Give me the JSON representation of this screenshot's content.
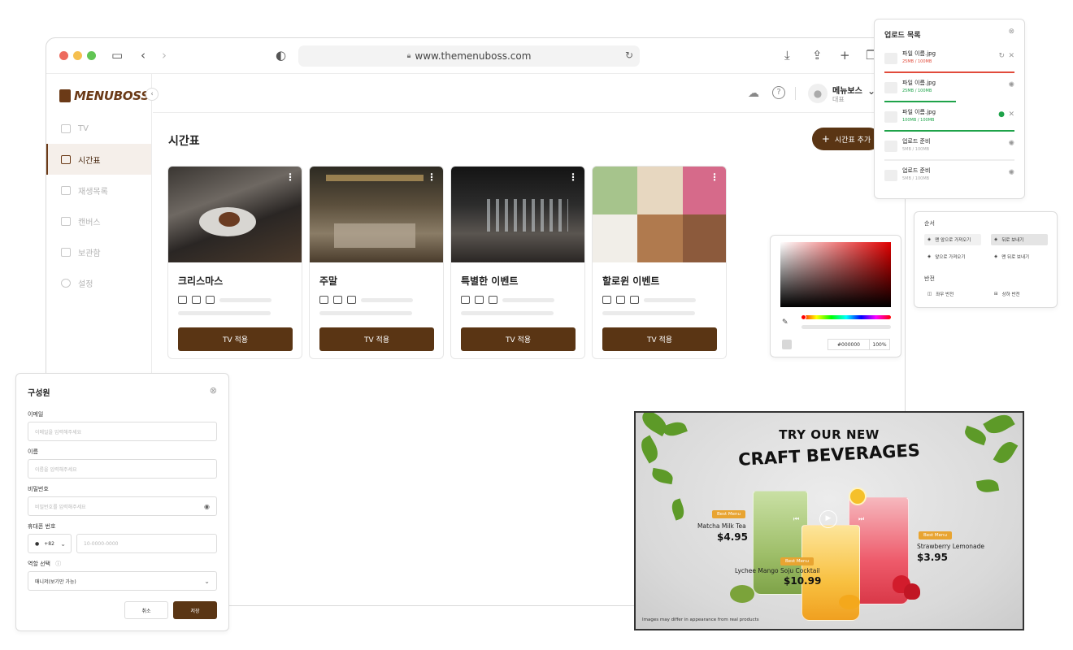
{
  "browser": {
    "url": "www.themenuboss.com",
    "traffic_colors": [
      "#ed6a5e",
      "#f5bf4f",
      "#61c554"
    ]
  },
  "brand": {
    "name": "MENUBOSS",
    "color": "#5a3514"
  },
  "sidebar": {
    "items": [
      {
        "label": "TV",
        "icon": "tv-icon",
        "active": false
      },
      {
        "label": "시간표",
        "icon": "calendar-icon",
        "active": true
      },
      {
        "label": "재생목록",
        "icon": "play-icon",
        "active": false
      },
      {
        "label": "캔버스",
        "icon": "canvas-icon",
        "active": false
      },
      {
        "label": "보관함",
        "icon": "archive-icon",
        "active": false
      },
      {
        "label": "설정",
        "icon": "gear-icon",
        "active": false
      }
    ]
  },
  "user": {
    "name": "메뉴보스",
    "role": "대표"
  },
  "page": {
    "title": "시간표",
    "add_button": "시간표 추가"
  },
  "schedules": [
    {
      "title": "크리스마스",
      "button": "TV 적용"
    },
    {
      "title": "주말",
      "button": "TV 적용"
    },
    {
      "title": "특별한 이벤트",
      "button": "TV 적용"
    },
    {
      "title": "할로윈 이벤트",
      "button": "TV 적용"
    }
  ],
  "upload": {
    "title": "업로드 목록",
    "items": [
      {
        "name": "파일 이름.jpg",
        "size": "25MB / 100MB",
        "progress": 1.0,
        "status": "error"
      },
      {
        "name": "파일 이름.jpg",
        "size": "25MB / 100MB",
        "progress": 0.55,
        "status": "uploading"
      },
      {
        "name": "파일 이름.jpg",
        "size": "100MB / 100MB",
        "progress": 1.0,
        "status": "done"
      },
      {
        "name": "업로드 준비",
        "size": "5MB / 100MB",
        "progress": 0,
        "status": "waiting"
      },
      {
        "name": "업로드 준비",
        "size": "5MB / 100MB",
        "progress": 0,
        "status": "waiting"
      }
    ]
  },
  "arrange": {
    "order_title": "순서",
    "order_buttons": [
      "맨 앞으로 가져오기",
      "뒤로 보내기",
      "앞으로 가져오기",
      "맨 뒤로 보내기"
    ],
    "flip_title": "반전",
    "flip_buttons": [
      "좌우 반전",
      "상하 반전"
    ]
  },
  "color_picker": {
    "hex": "#000000",
    "opacity": "100%"
  },
  "member_form": {
    "title": "구성원",
    "email_label": "이메일",
    "email_placeholder": "이메일을 입력해주세요",
    "name_label": "이름",
    "name_placeholder": "이름을 입력해주세요",
    "password_label": "비밀번호",
    "password_placeholder": "비밀번호를 입력해주세요",
    "phone_label": "휴대폰 번호",
    "country_code": "+82",
    "phone_placeholder": "10-0000-0000",
    "role_label": "역할 선택",
    "role_value": "매니저(보기만 가능)",
    "cancel": "취소",
    "save": "저장"
  },
  "promo": {
    "headline_1": "TRY OUR NEW",
    "headline_2": "CRAFT BEVERAGES",
    "items": [
      {
        "badge": "Best Menu",
        "name": "Matcha Milk Tea",
        "price": "$4.95"
      },
      {
        "badge": "Best Menu",
        "name": "Lychee Mango Soju Cocktail",
        "price": "$10.99"
      },
      {
        "badge": "Best Menu",
        "name": "Strawberry Lemonade",
        "price": "$3.95"
      }
    ],
    "disclaimer": "Images may differ in appearance from real products"
  }
}
